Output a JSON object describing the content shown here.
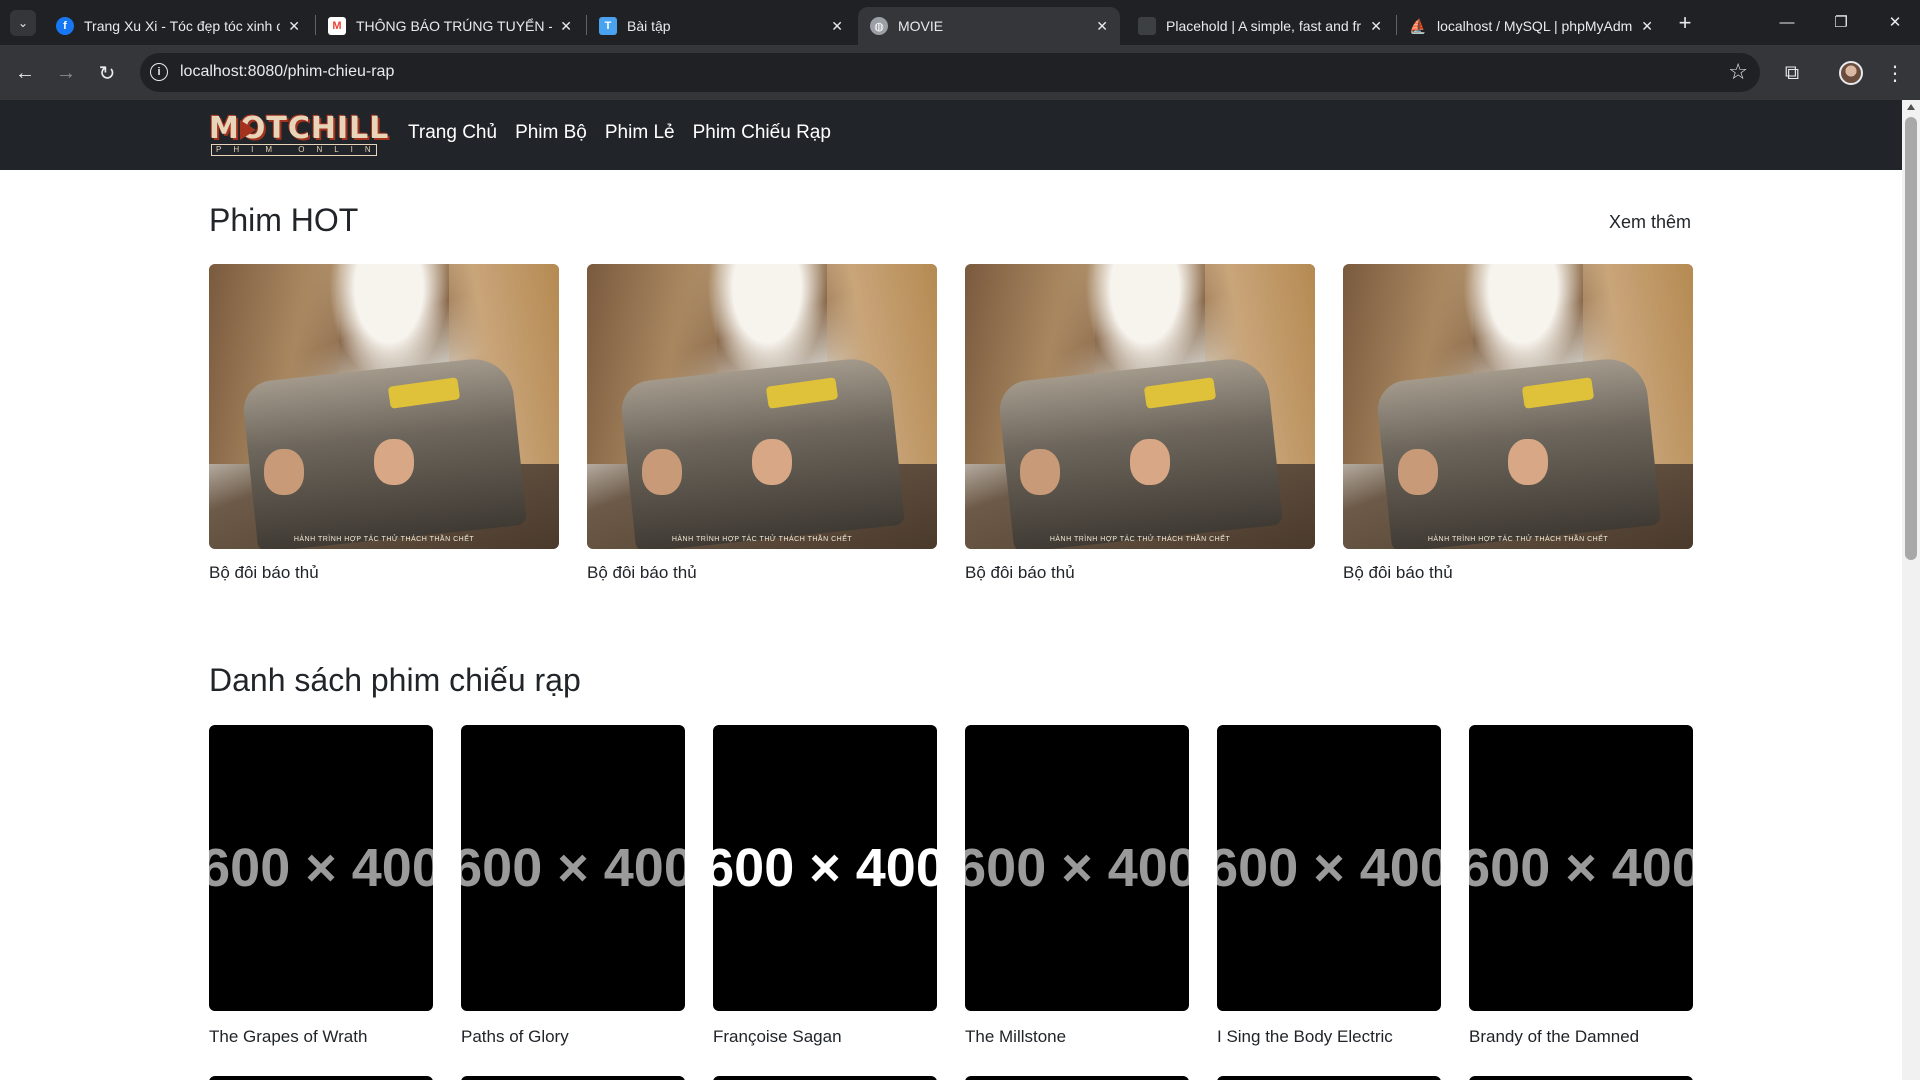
{
  "browser": {
    "tabs": [
      {
        "title": "Trang Xu Xi - Tóc đẹp tóc xinh c",
        "favicon": "facebook-icon",
        "color": "#1877f2"
      },
      {
        "title": "THÔNG BÁO TRÚNG TUYỂN - v",
        "favicon": "gmail-icon",
        "color": "#ea4335"
      },
      {
        "title": "Bài tập",
        "favicon": "classroom-icon",
        "color": "#4aa3f0"
      },
      {
        "title": "MOVIE",
        "favicon": "globe-icon",
        "color": "#9aa0a6",
        "active": true
      },
      {
        "title": "Placehold | A simple, fast and fr",
        "favicon": "placehold-icon",
        "color": "#3c4043"
      },
      {
        "title": "localhost / MySQL | phpMyAdm",
        "favicon": "phpmyadmin-icon",
        "color": "#f29111"
      }
    ],
    "url": "localhost:8080/phim-chieu-rap"
  },
  "site": {
    "logo": {
      "main": "MOTCHILL",
      "sub": "PHIM ONLINE"
    },
    "nav": [
      "Trang Chủ",
      "Phim Bộ",
      "Phim Lẻ",
      "Phim Chiếu Rạp"
    ]
  },
  "hot": {
    "title": "Phim HOT",
    "see_more": "Xem thêm",
    "poster_caption": "HÀNH TRÌNH HỢP TÁC THỬ THÁCH THẦN CHẾT",
    "items": [
      "Bộ đôi báo thủ",
      "Bộ đôi báo thủ",
      "Bộ đôi báo thủ",
      "Bộ đôi báo thủ"
    ]
  },
  "cinema": {
    "title": "Danh sách phim chiếu rạp",
    "placeholder_text": "600 × 400",
    "items": [
      "The Grapes of Wrath",
      "Paths of Glory",
      "Françoise Sagan",
      "The Millstone",
      "I Sing the Body Electric",
      "Brandy of the Damned"
    ]
  }
}
